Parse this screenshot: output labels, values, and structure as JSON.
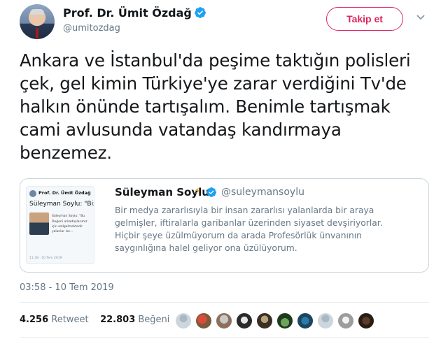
{
  "author": {
    "name": "Prof. Dr. Ümit Özdağ",
    "handle": "@umitozdag"
  },
  "follow_button": {
    "label": "Takip et"
  },
  "tweet": {
    "lines": [
      "Ankara ve İstanbul'da peşime taktığın polisleri",
      "çek, gel kimin Türkiye'ye zarar verdiğini Tv'de",
      "halkın önünde tartışalım. Benimle tartışmak",
      "cami avlusunda vatandaş kandırmaya",
      "benzemez."
    ],
    "timestamp": "03:58 - 10 Tem 2019"
  },
  "quoted_tweet": {
    "name": "Süleyman Soylu",
    "handle": "@suleymansoylu",
    "body_lines": [
      "Bir medya zararlısıyla bir insan zararlısı yalanlarda bir araya",
      "gelmişler, iftiralarla garibanlar üzerinden siyaset devşiriyorlar.",
      "Hiçbir şeye üzülmüyorum da arada Profesörlük ünvanının",
      "saygınlığına halel geliyor ona üzülüyorum."
    ],
    "thumbnail": {
      "author": "Prof. Dr. Ümit Özdağ",
      "headline": "Süleyman Soylu: \"Bizi",
      "small_lines": [
        "Süleyman Soylu: \"Bu",
        "Değerli arkadaşlarımız",
        "için ezilgelmektedir",
        "yalanlar ise..."
      ],
      "footer": "11:38 · 10 Tem 2019"
    }
  },
  "stats": {
    "retweet_count": "4.256",
    "retweet_label": "Retweet",
    "like_count": "22.803",
    "like_label": "Beğeni"
  },
  "colors": {
    "follow_accent": "#e0245e",
    "verified": "#1da1f2",
    "muted": "#657786"
  },
  "icons": [
    "verified-badge-icon",
    "chevron-down-icon",
    "lightning-icon"
  ]
}
